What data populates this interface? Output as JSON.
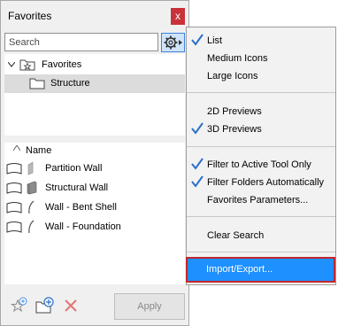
{
  "palette": {
    "title": "Favorites",
    "close_glyph": "x",
    "search_placeholder": "Search",
    "tree": {
      "root": "Favorites",
      "child": "Structure"
    },
    "column_header": "Name",
    "items": [
      {
        "label": "Partition Wall",
        "icon": "partition-wall-icon"
      },
      {
        "label": "Structural Wall",
        "icon": "structural-wall-icon"
      },
      {
        "label": "Wall - Bent Shell",
        "icon": "bent-shell-wall-icon"
      },
      {
        "label": "Wall - Foundation",
        "icon": "foundation-wall-icon"
      }
    ],
    "apply_label": "Apply"
  },
  "menu": {
    "view_mode": [
      "List",
      "Medium Icons",
      "Large Icons"
    ],
    "previews": [
      "2D Previews",
      "3D Previews"
    ],
    "filters": [
      "Filter to Active Tool Only",
      "Filter Folders Automatically",
      "Favorites Parameters..."
    ],
    "clear": "Clear Search",
    "import_export": "Import/Export...",
    "checked": [
      "List",
      "3D Previews",
      "Filter to Active Tool Only",
      "Filter Folders Automatically"
    ]
  },
  "colors": {
    "highlight": "#1e90ff",
    "highlight_border": "#c0272d",
    "check": "#2a6fc9",
    "close": "#c8323a"
  }
}
